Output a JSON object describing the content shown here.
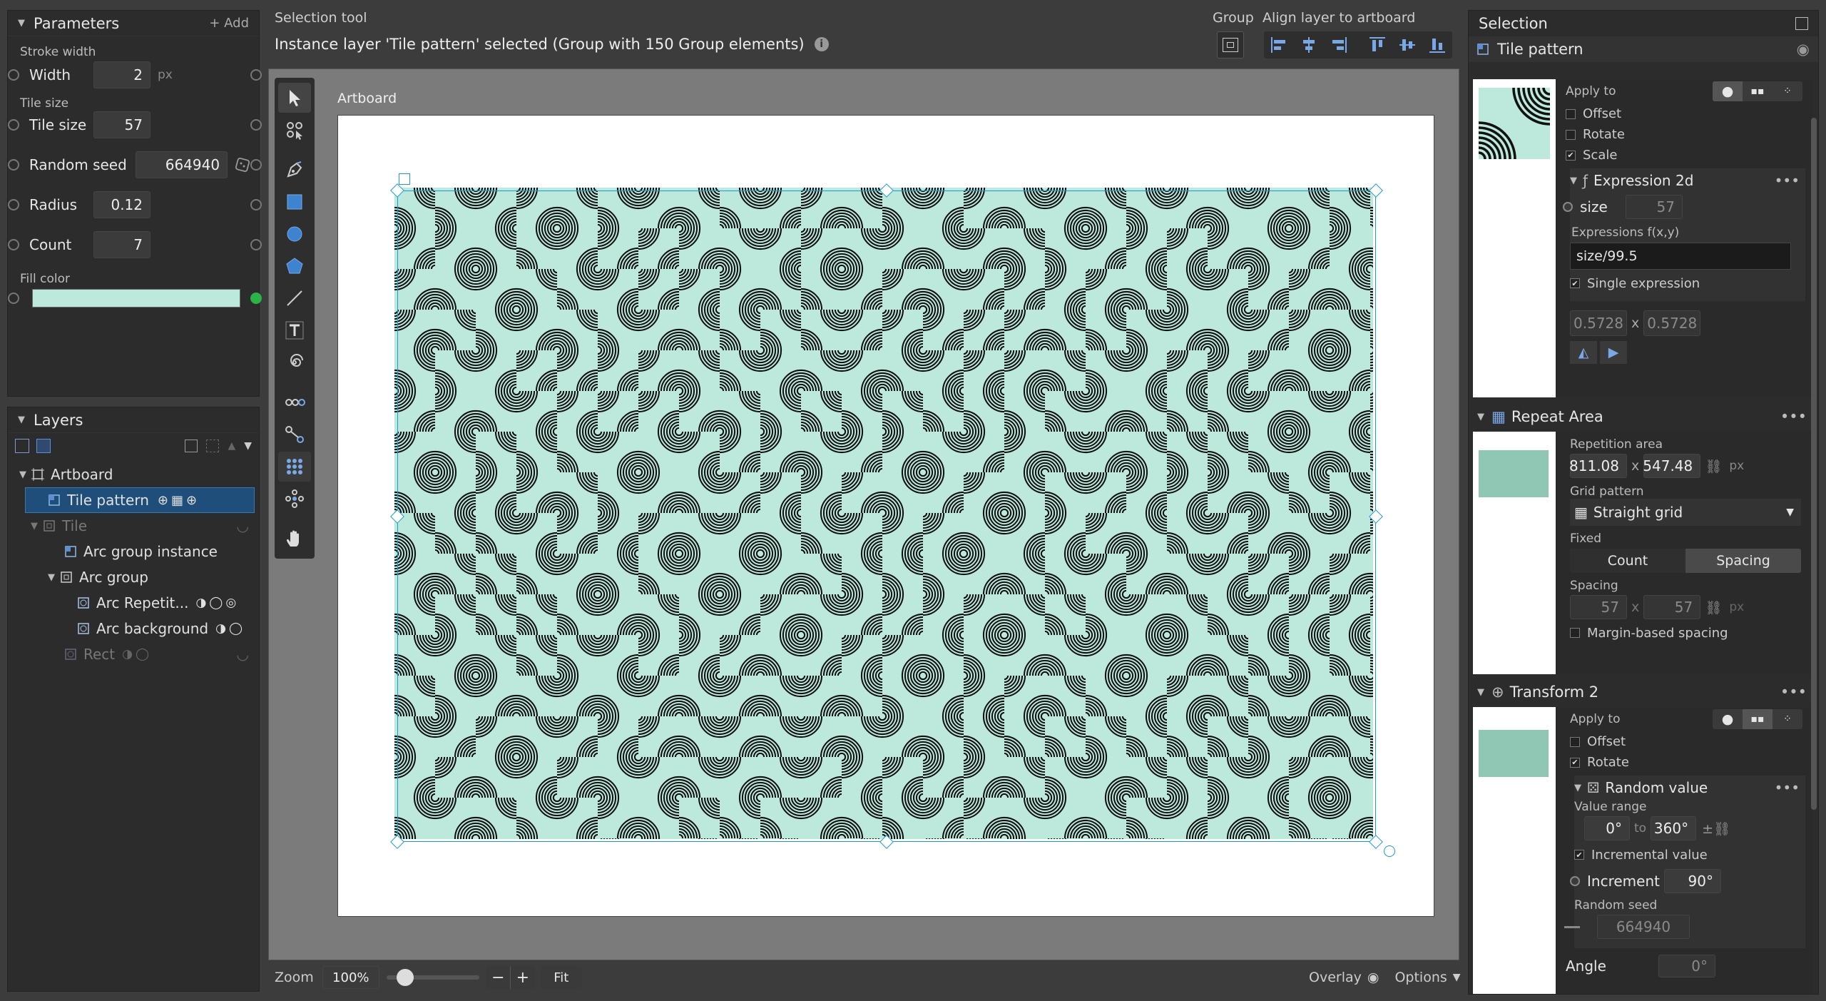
{
  "parameters": {
    "title": "Parameters",
    "add_label": "+ Add",
    "stroke_width_group": "Stroke width",
    "width_label": "Width",
    "width_value": "2",
    "width_unit": "px",
    "tile_size_group": "Tile size",
    "tile_size_label": "Tile size",
    "tile_size_value": "57",
    "random_seed_label": "Random seed",
    "random_seed_value": "664940",
    "radius_label": "Radius",
    "radius_value": "0.12",
    "count_label": "Count",
    "count_value": "7",
    "fill_color_label": "Fill color",
    "fill_color_hex": "#bde8dc"
  },
  "layers": {
    "title": "Layers",
    "items": [
      {
        "label": "Artboard"
      },
      {
        "label": "Tile pattern"
      },
      {
        "label": "Tile"
      },
      {
        "label": "Arc group instance"
      },
      {
        "label": "Arc group"
      },
      {
        "label": "Arc Repetit..."
      },
      {
        "label": "Arc background"
      },
      {
        "label": "Rect"
      }
    ]
  },
  "header": {
    "tool_name": "Selection tool",
    "status": "Instance layer 'Tile pattern' selected (Group with 150 Group elements)",
    "group_label": "Group",
    "align_label": "Align layer to artboard"
  },
  "canvas": {
    "artboard_label": "Artboard",
    "pattern_color": "#bde8dc",
    "stroke_color": "#111111"
  },
  "bottom": {
    "zoom_label": "Zoom",
    "zoom_value": "100%",
    "zoom_fraction": 0.2,
    "minus": "−",
    "plus": "+",
    "fit_label": "Fit",
    "overlay_label": "Overlay",
    "options_label": "Options"
  },
  "selection": {
    "title": "Selection",
    "layer_name": "Tile pattern",
    "apply_to_label": "Apply to",
    "offset_label": "Offset",
    "rotate_label": "Rotate",
    "scale_label": "Scale",
    "expr_title": "Expression 2d",
    "size_label": "size",
    "size_value": "57",
    "expr_label": "Expressions f(x,y)",
    "expr_value": "size/99.5",
    "single_expr_label": "Single expression",
    "out_x": "0.5728",
    "out_y": "0.5728",
    "x_sep": "x",
    "repeat_title": "Repeat Area",
    "repetition_label": "Repetition area",
    "rep_w": "811.08",
    "rep_h": "547.48",
    "rep_unit": "px",
    "grid_label": "Grid pattern",
    "grid_value": "Straight grid",
    "fixed_label": "Fixed",
    "count_tab": "Count",
    "spacing_tab": "Spacing",
    "spacing_label": "Spacing",
    "spacing_x": "57",
    "spacing_y": "57",
    "spacing_unit": "px",
    "margin_label": "Margin-based spacing",
    "transform_title": "Transform 2",
    "apply_to2_label": "Apply to",
    "offset2_label": "Offset",
    "rotate2_label": "Rotate",
    "random_title": "Random value",
    "value_range_label": "Value range",
    "range_from": "0°",
    "range_to_label": "to",
    "range_to": "360°",
    "incremental_label": "Incremental value",
    "increment_label": "Increment",
    "increment_value": "90°",
    "seed_label": "Random seed",
    "seed_value": "664940",
    "angle_label": "Angle",
    "angle_value": "0°"
  }
}
